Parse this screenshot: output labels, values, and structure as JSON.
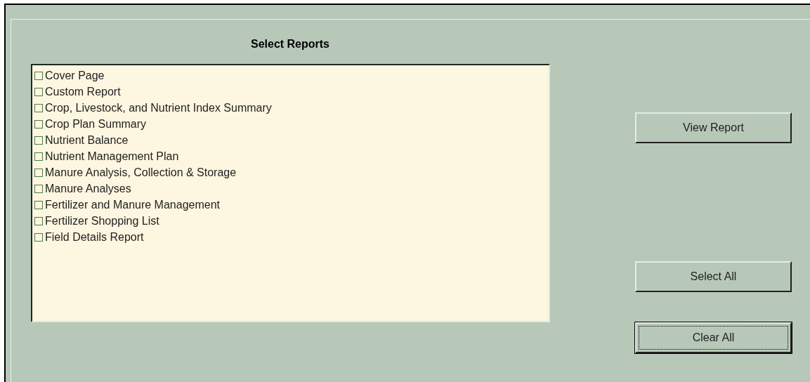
{
  "title": "Select Reports",
  "reports": [
    {
      "label": "Cover Page",
      "checked": false
    },
    {
      "label": "Custom Report",
      "checked": false
    },
    {
      "label": "Crop, Livestock, and Nutrient Index Summary",
      "checked": false
    },
    {
      "label": "Crop Plan Summary",
      "checked": false
    },
    {
      "label": "Nutrient Balance",
      "checked": false
    },
    {
      "label": "Nutrient Management Plan",
      "checked": false
    },
    {
      "label": "Manure Analysis, Collection & Storage",
      "checked": false
    },
    {
      "label": "Manure Analyses",
      "checked": false
    },
    {
      "label": "Fertilizer and Manure Management",
      "checked": false
    },
    {
      "label": "Fertilizer Shopping List",
      "checked": false
    },
    {
      "label": "Field Details Report",
      "checked": false
    }
  ],
  "buttons": [
    {
      "label": "View Report",
      "focused": false
    },
    {
      "label": "Select All",
      "focused": false
    },
    {
      "label": "Clear All",
      "focused": true
    }
  ]
}
